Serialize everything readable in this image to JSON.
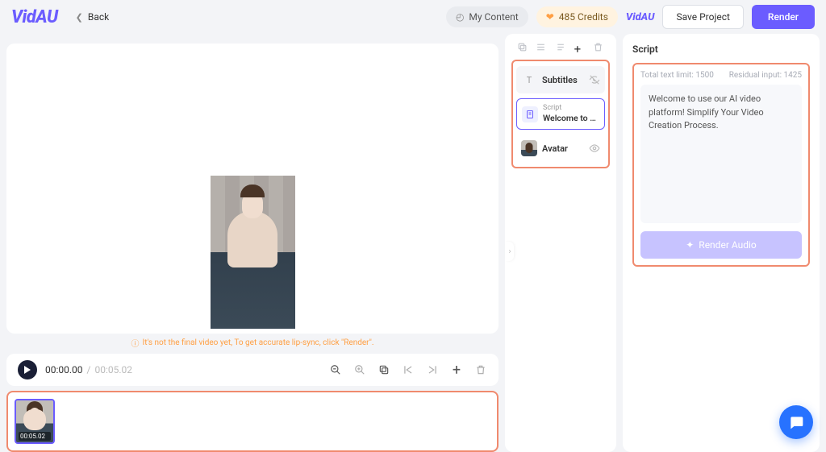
{
  "header": {
    "logo": "VidAU",
    "back": "Back",
    "my_content": "My Content",
    "credits": "485 Credits",
    "small_logo": "VidAU",
    "save": "Save Project",
    "render": "Render"
  },
  "preview": {
    "notice": "It's not the final video yet, To get accurate lip-sync, click \"Render\"."
  },
  "timeline": {
    "current": "00:00.00",
    "separator": "/",
    "duration": "00:05.02"
  },
  "thumb": {
    "dur": "00:05.02"
  },
  "layers": {
    "subtitles": "Subtitles",
    "script_label": "Script",
    "script_text": "Welcome to u…",
    "avatar": "Avatar"
  },
  "script_panel": {
    "title": "Script",
    "limit_left": "Total text limit: 1500",
    "limit_right": "Residual input: 1425",
    "text": "Welcome to use our AI video platform! Simplify Your Video Creation Process.",
    "render_audio": "Render Audio"
  }
}
